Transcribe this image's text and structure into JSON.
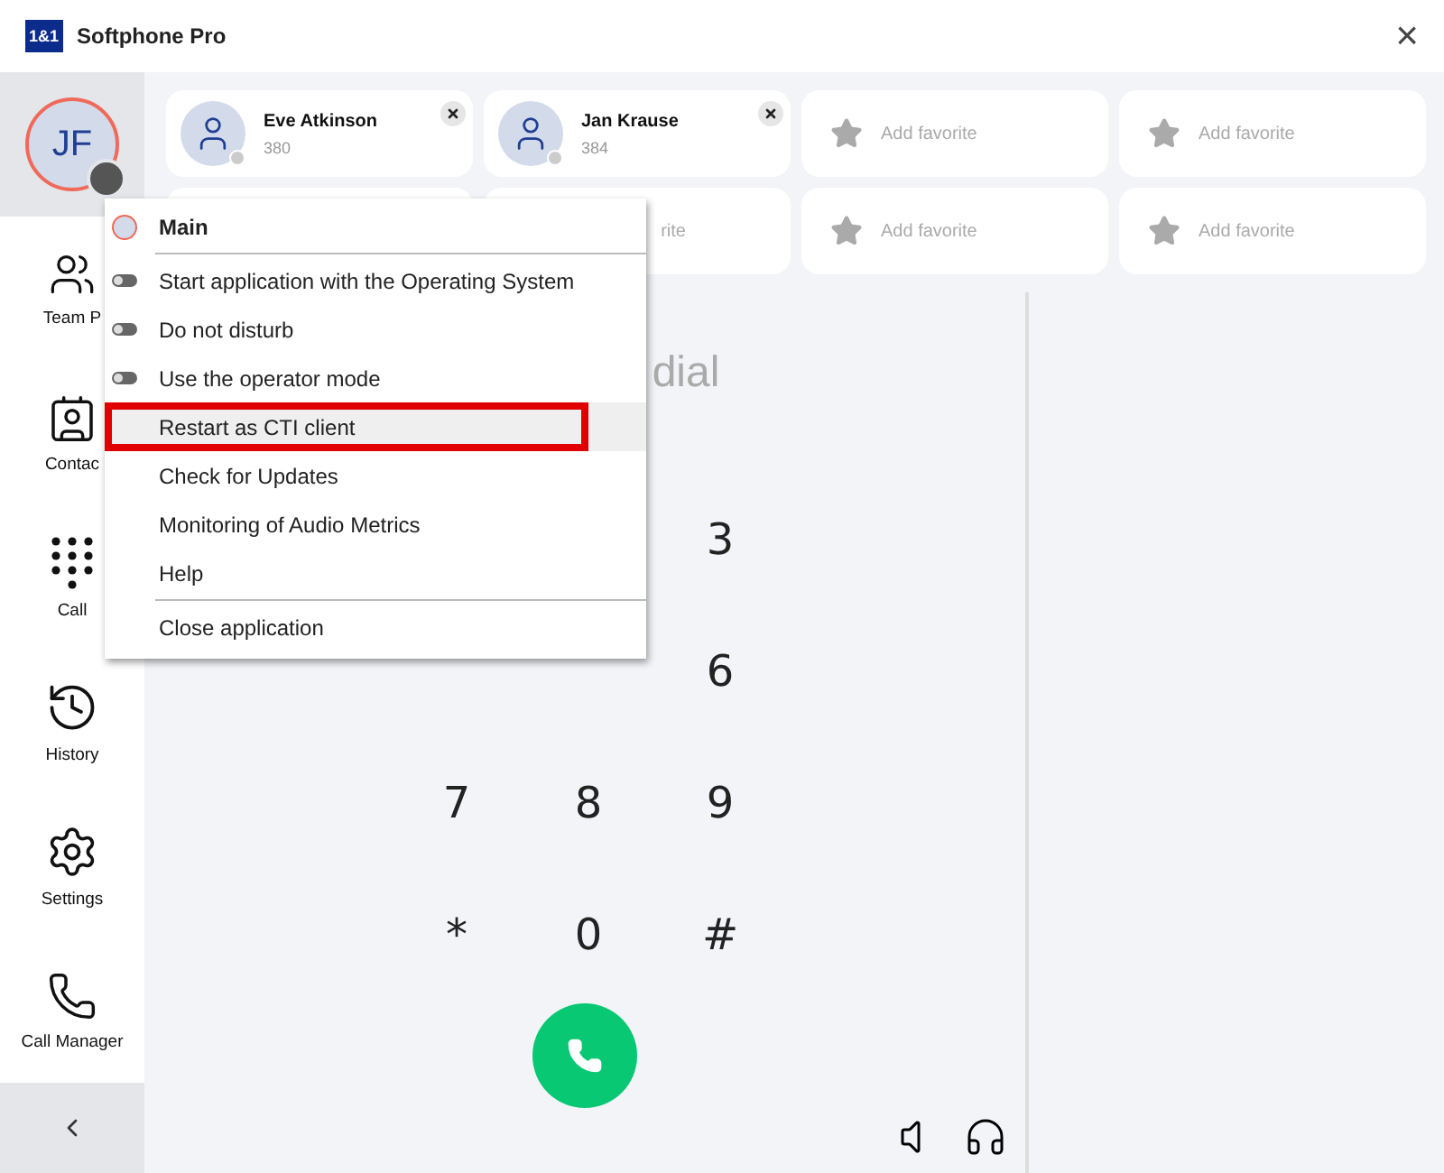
{
  "window": {
    "logo": "1&1",
    "title": "Softphone Pro",
    "close": "×"
  },
  "user": {
    "initials": "JF",
    "online": false
  },
  "sidebar": {
    "items": [
      {
        "label": "Team P"
      },
      {
        "label": "Contac"
      },
      {
        "label": "Call"
      },
      {
        "label": "History"
      },
      {
        "label": "Settings"
      },
      {
        "label": "Call Manager"
      }
    ]
  },
  "favorites": [
    {
      "kind": "contact",
      "name": "Eve Atkinson",
      "number": "380"
    },
    {
      "kind": "contact",
      "name": "Jan Krause",
      "number": "384"
    },
    {
      "kind": "empty",
      "label": "Add favorite"
    },
    {
      "kind": "empty",
      "label": "Add favorite"
    },
    {
      "kind": "covered"
    },
    {
      "kind": "partial",
      "label": "rite"
    },
    {
      "kind": "empty",
      "label": "Add favorite"
    },
    {
      "kind": "empty",
      "label": "Add favorite"
    }
  ],
  "dialer": {
    "placeholder": "dial",
    "keys": [
      {
        "kind": "covered"
      },
      {
        "kind": "covered"
      },
      {
        "kind": "key",
        "label": "3"
      },
      {
        "kind": "covered"
      },
      {
        "kind": "covered"
      },
      {
        "kind": "key",
        "label": "6"
      },
      {
        "kind": "key",
        "label": "7"
      },
      {
        "kind": "key",
        "label": "8"
      },
      {
        "kind": "key",
        "label": "9"
      },
      {
        "kind": "key",
        "label": "*"
      },
      {
        "kind": "key",
        "label": "0"
      },
      {
        "kind": "key",
        "label": "#"
      }
    ]
  },
  "menu": {
    "items": [
      {
        "kind": "header",
        "label": "Main",
        "highlighted": false
      },
      {
        "kind": "toggle",
        "label": "Start application with the Operating System",
        "on": false,
        "highlighted": false,
        "divider_before": true
      },
      {
        "kind": "toggle",
        "label": "Do not disturb",
        "on": false,
        "highlighted": false
      },
      {
        "kind": "toggle",
        "label": "Use the operator mode",
        "on": false,
        "highlighted": false
      },
      {
        "kind": "action",
        "label": "Restart as CTI client",
        "highlighted": true
      },
      {
        "kind": "action",
        "label": "Check for Updates",
        "highlighted": false
      },
      {
        "kind": "action",
        "label": "Monitoring of Audio Metrics",
        "highlighted": false
      },
      {
        "kind": "action",
        "label": "Help",
        "highlighted": false
      },
      {
        "kind": "action",
        "label": "Close application",
        "highlighted": false,
        "divider_before": true
      }
    ]
  }
}
